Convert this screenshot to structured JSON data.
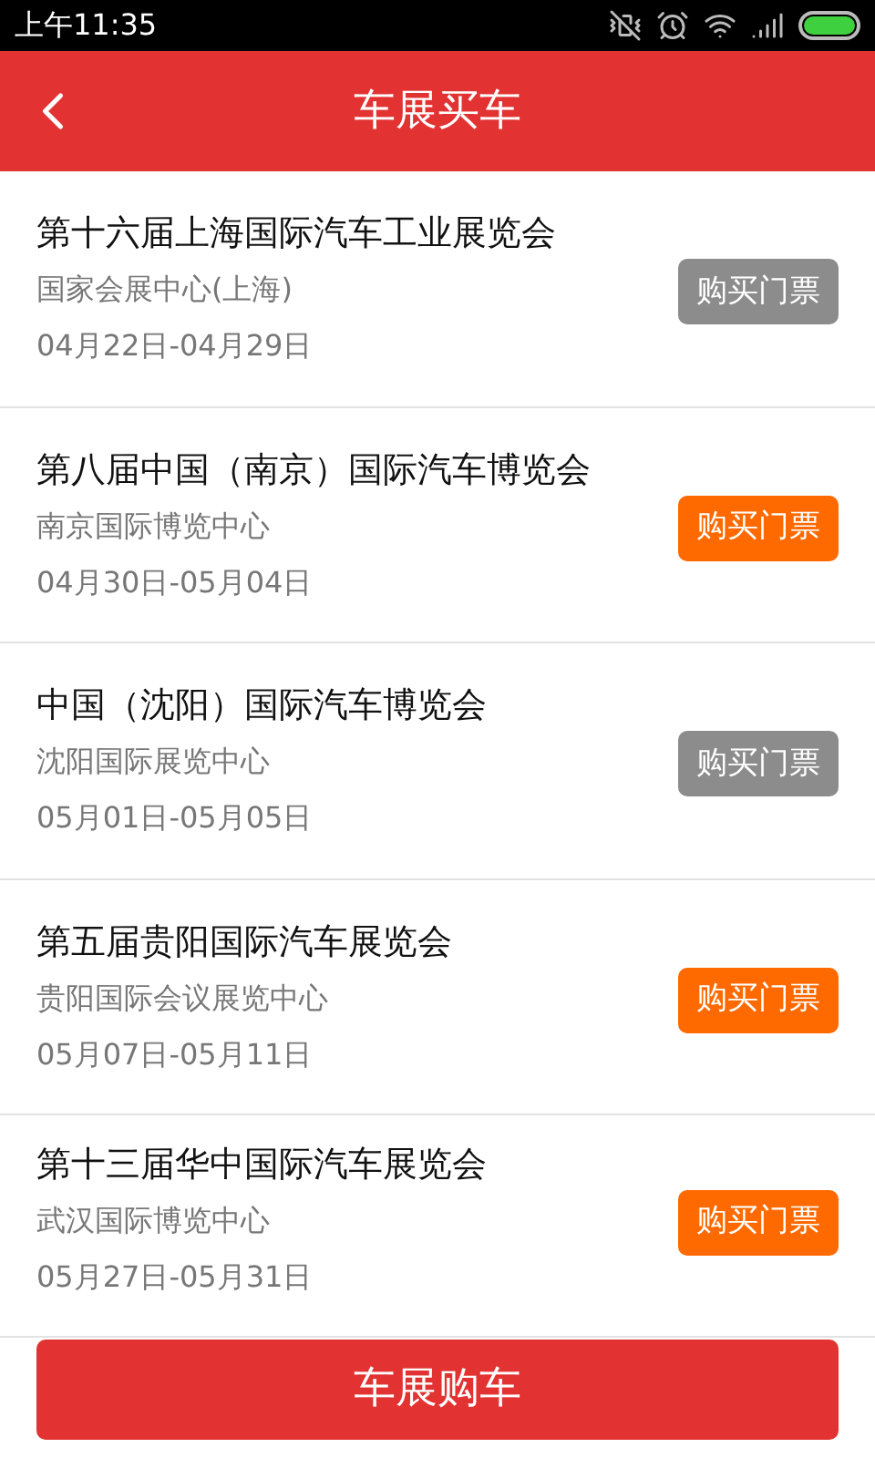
{
  "status_bar": {
    "time": "上午11:35"
  },
  "header": {
    "title": "车展买车"
  },
  "exhibitions": [
    {
      "title": "第十六届上海国际汽车工业展览会",
      "venue": "国家会展中心(上海)",
      "dates": "04月22日-04月29日",
      "button": "购买门票",
      "available": false
    },
    {
      "title": "第八届中国（南京）国际汽车博览会",
      "venue": "南京国际博览中心",
      "dates": "04月30日-05月04日",
      "button": "购买门票",
      "available": true
    },
    {
      "title": "中国（沈阳）国际汽车博览会",
      "venue": "沈阳国际展览中心",
      "dates": "05月01日-05月05日",
      "button": "购买门票",
      "available": false
    },
    {
      "title": "第五届贵阳国际汽车展览会",
      "venue": "贵阳国际会议展览中心",
      "dates": "05月07日-05月11日",
      "button": "购买门票",
      "available": true
    },
    {
      "title": "第十三届华中国际汽车展览会",
      "venue": "武汉国际博览中心",
      "dates": "05月27日-05月31日",
      "button": "购买门票",
      "available": true
    }
  ],
  "bottom_button": "车展购车"
}
